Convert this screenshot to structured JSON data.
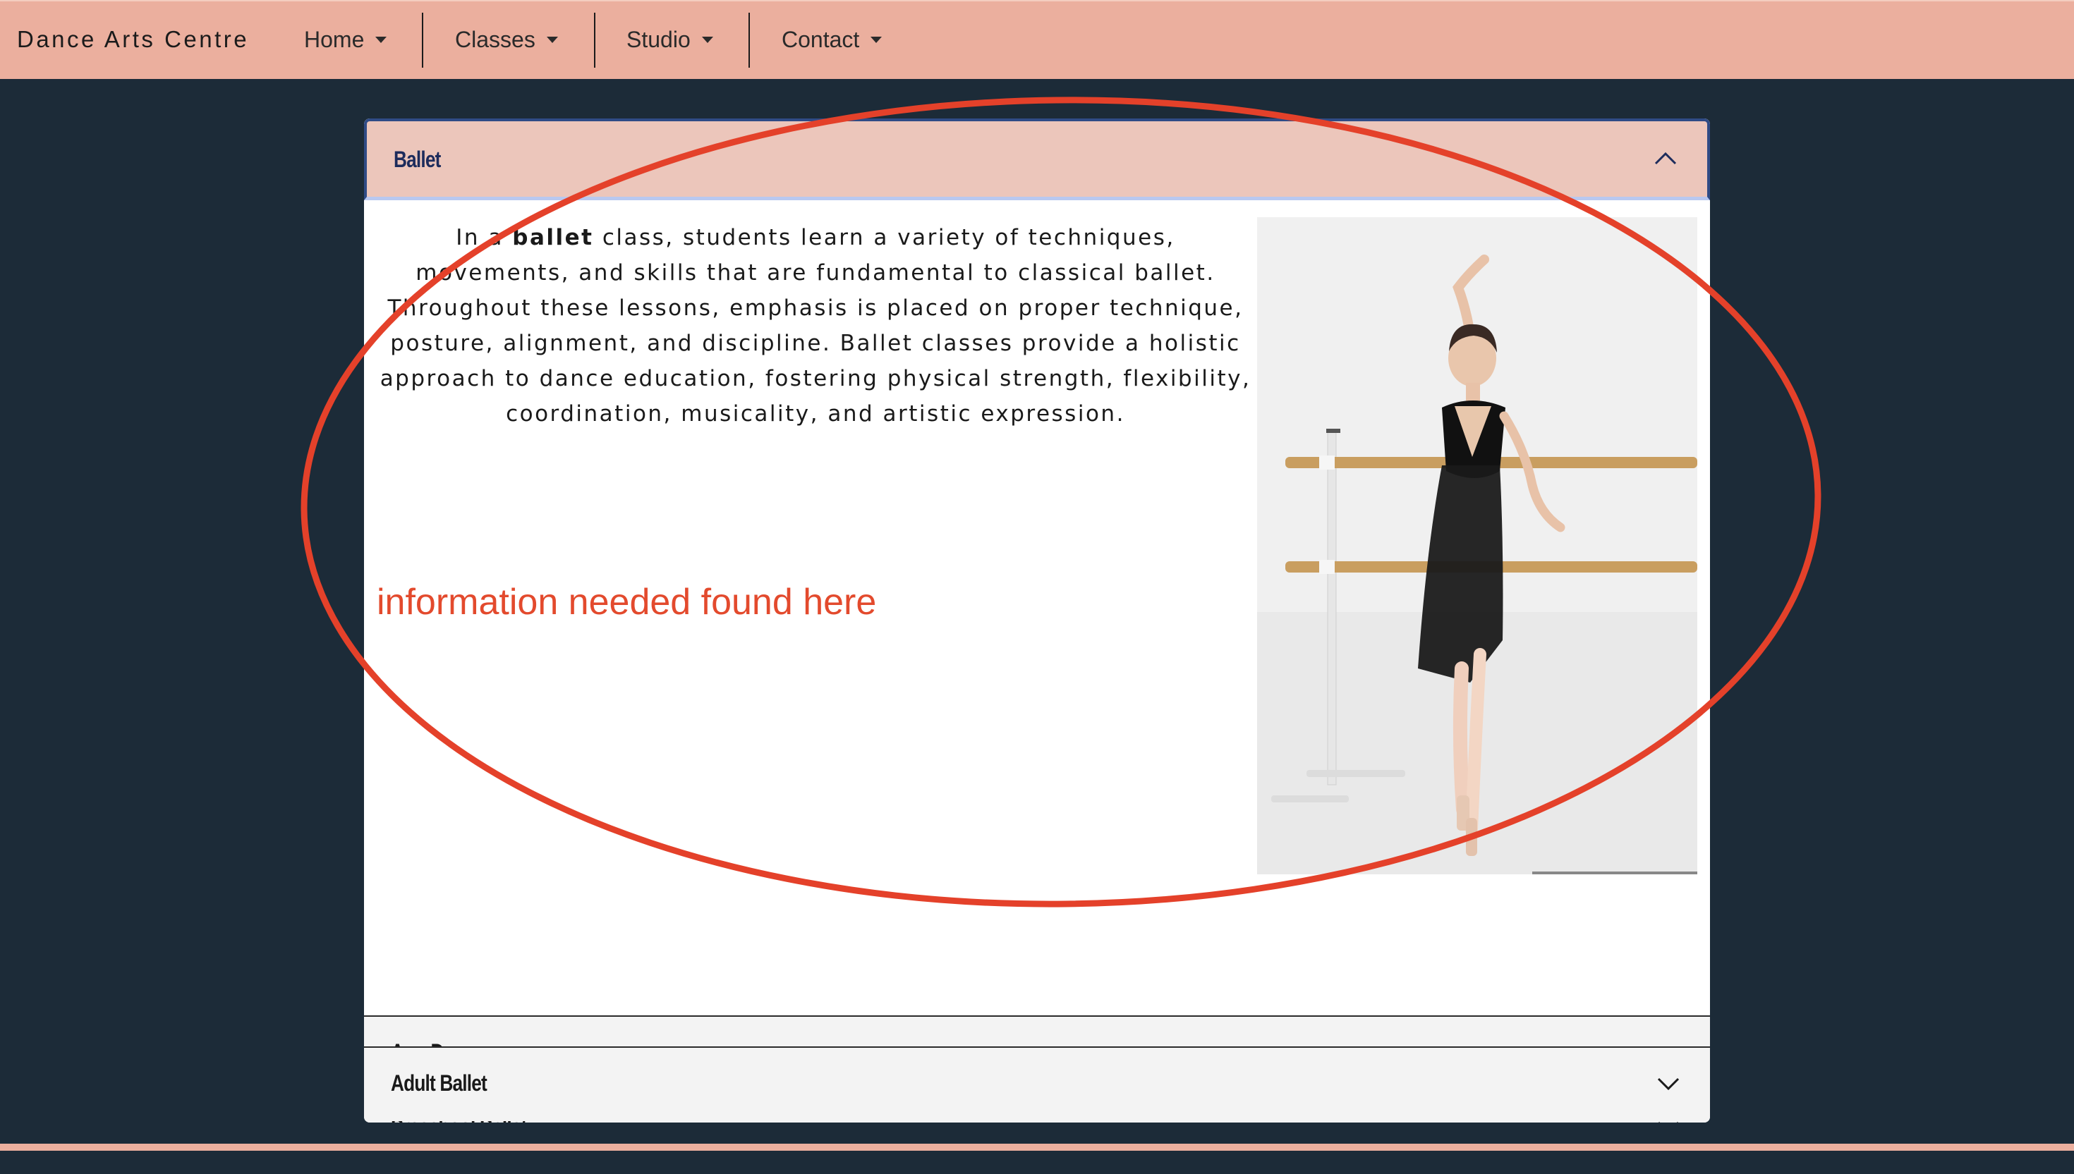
{
  "navbar": {
    "brand": "Dance Arts Centre",
    "items": [
      {
        "label": "Home"
      },
      {
        "label": "Classes"
      },
      {
        "label": "Studio"
      },
      {
        "label": "Contact"
      }
    ]
  },
  "accordion": {
    "open_item": {
      "title": "Ballet",
      "text_lead": "In a ",
      "text_bold": "ballet",
      "text_rest": " class, students learn a variety of techniques, movements, and skills that are fundamental to classical ballet. Throughout these lessons, emphasis is placed on proper technique, posture, alignment, and discipline. Ballet classes provide a holistic approach to dance education, fostering physical strength, flexibility, coordination, musicality, and artistic expression.",
      "image_icon": "ballet-dancer-photo"
    },
    "collapsed_items": [
      {
        "title": "AcroDance"
      },
      {
        "title": "Preschool Ballet"
      },
      {
        "title": "Adult Ballet"
      }
    ]
  },
  "annotation": {
    "text": "information needed found here",
    "color": "#e34a2d"
  },
  "colors": {
    "navbar_bg": "#ebaf9e",
    "page_bg": "#1c2b38",
    "open_header_bg": "#ecc6bb",
    "collapsed_header_bg": "#f3f3f3"
  }
}
